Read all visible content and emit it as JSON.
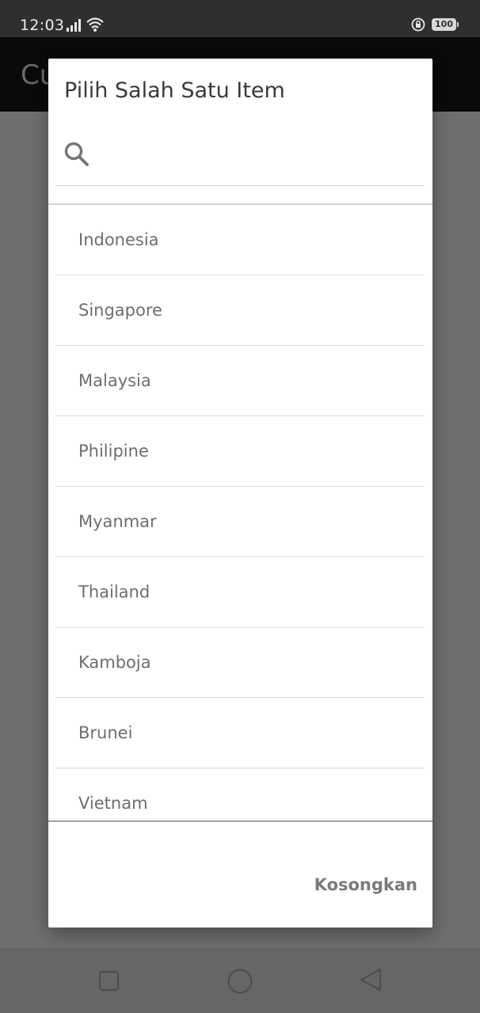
{
  "status_bar": {
    "time": "12:03",
    "battery": "100",
    "icons": [
      "signal-icon",
      "wifi-icon",
      "lock-rotation-icon",
      "battery-icon"
    ]
  },
  "app_bar": {
    "title_partial": "Cu"
  },
  "dialog": {
    "title": "Pilih Salah Satu Item",
    "search": {
      "value": "",
      "placeholder": "",
      "icon": "search-icon"
    },
    "items": [
      {
        "label": "Indonesia"
      },
      {
        "label": "Singapore"
      },
      {
        "label": "Malaysia"
      },
      {
        "label": "Philipine"
      },
      {
        "label": "Myanmar"
      },
      {
        "label": "Thailand"
      },
      {
        "label": "Kamboja"
      },
      {
        "label": "Brunei"
      },
      {
        "label": "Vietnam"
      }
    ],
    "clear_label": "Kosongkan"
  },
  "nav_bar": {
    "icons": [
      "recents-square-icon",
      "home-circle-icon",
      "back-triangle-icon"
    ]
  },
  "colors": {
    "scrim": "#6f6f6f",
    "status_bar": "#2f2f2f",
    "app_bar": "#0a0a0a",
    "dialog": "#ffffff",
    "item_text": "#6e6e6e",
    "button_text": "#7a7a7a"
  }
}
